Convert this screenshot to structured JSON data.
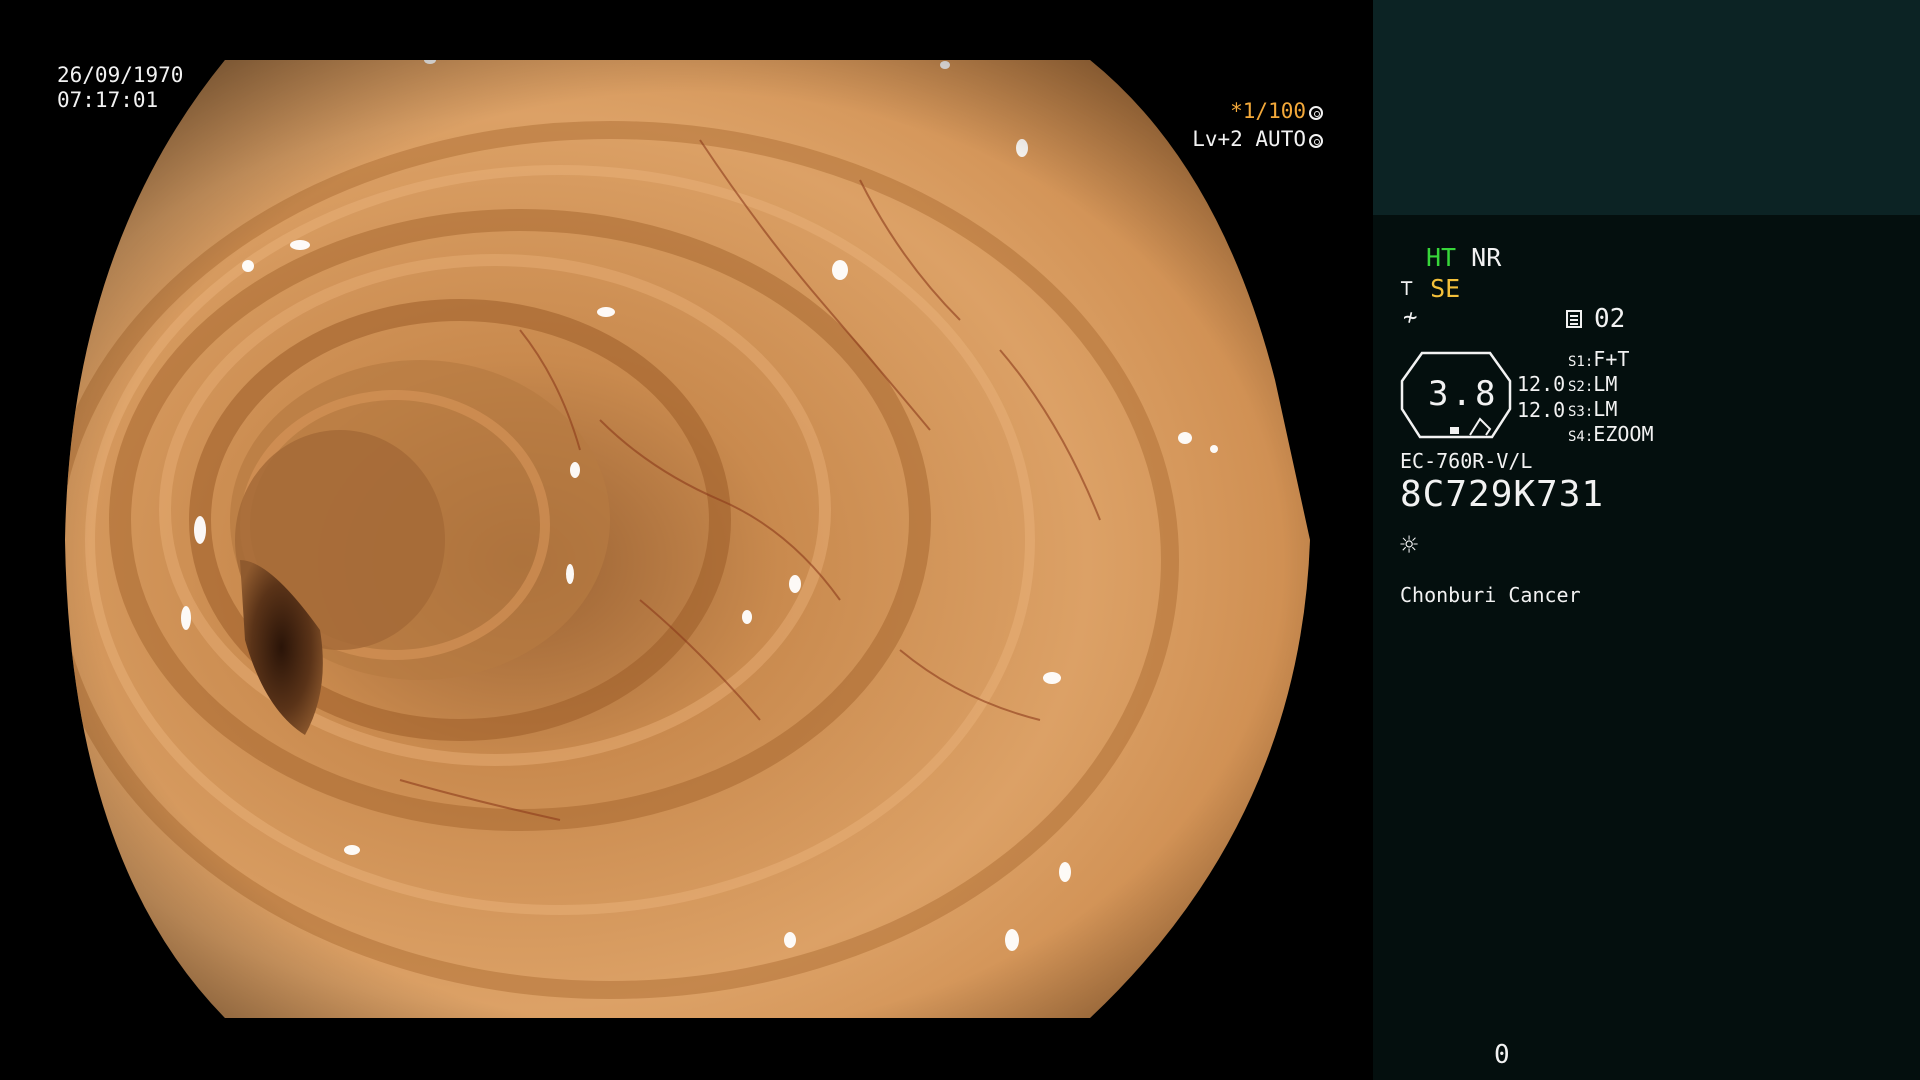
{
  "overlay": {
    "date": "26/09/1970",
    "time": "07:17:01",
    "shutter": "*1/100",
    "level": "Lv+2 AUTO"
  },
  "info_panel": {
    "mode_ht": "HT",
    "mode_nr": "NR",
    "se": "SE",
    "memo_number": "02",
    "octagon_value": "3.8",
    "value_a": "12.0",
    "value_b": "12.0",
    "switches": [
      {
        "label": "S1:",
        "value": "F+T"
      },
      {
        "label": "S2:",
        "value": "LM"
      },
      {
        "label": "S3:",
        "value": "LM"
      },
      {
        "label": "S4:",
        "value": "EZOOM"
      }
    ],
    "scope_model": "EC-760R-V/L",
    "serial": "8C729K731",
    "hospital": "Chonburi Cancer",
    "counter": "0"
  },
  "colors": {
    "panel_top": "#0c2324",
    "panel_bg": "#040f0e",
    "ht_green": "#37d63a",
    "se_yellow": "#f4c03a",
    "shutter_orange": "#f4a93a"
  },
  "icons": [
    "shutter-icon",
    "ring-icon",
    "scope-angle-icon",
    "slash-icon",
    "memo-icon",
    "light-icon"
  ]
}
